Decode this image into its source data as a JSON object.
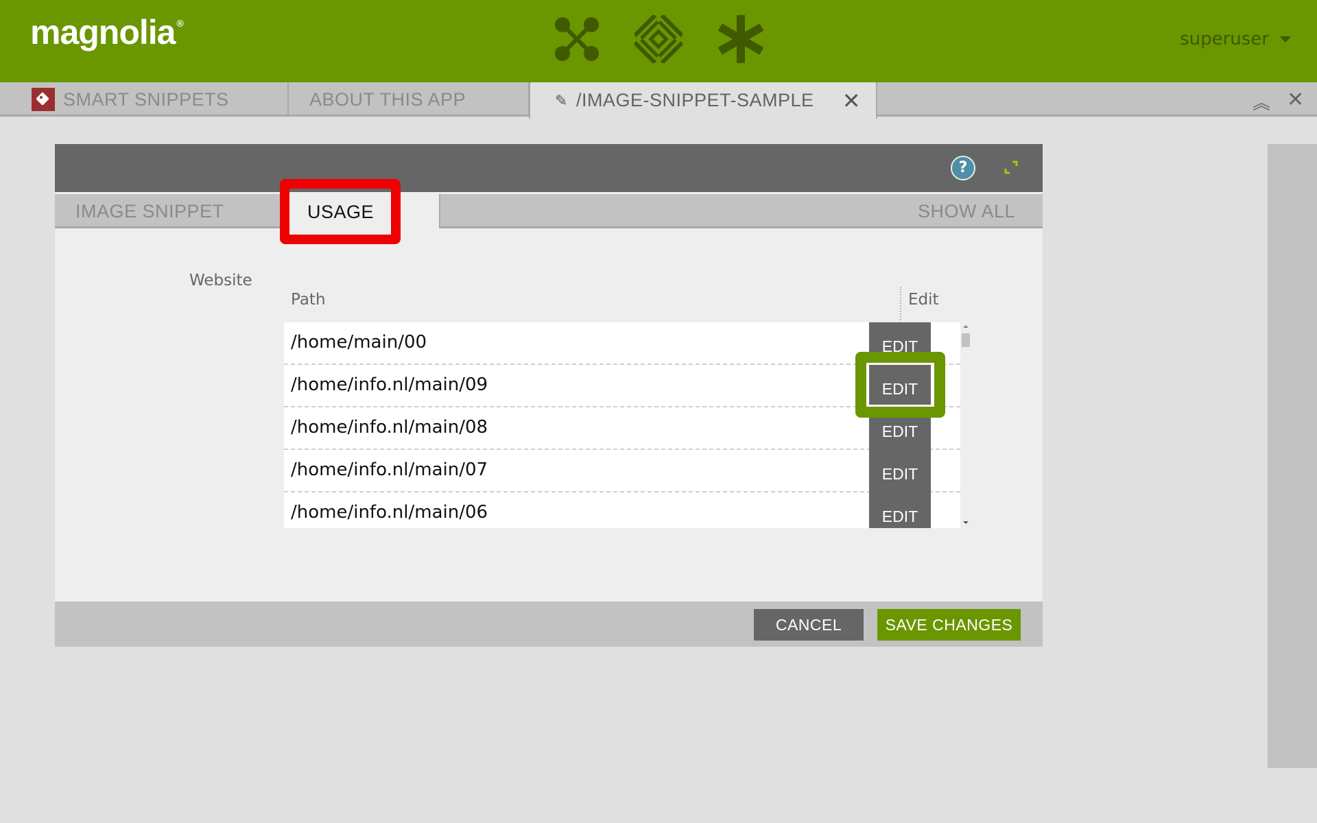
{
  "header": {
    "logo": "magnolia",
    "logo_mark": "®",
    "app_icons": [
      "apps-launcher-icon",
      "pulse-icon",
      "favorites-icon"
    ],
    "user": "superuser"
  },
  "app_tabs": [
    {
      "label": "SMART SNIPPETS",
      "icon": "tag-icon"
    },
    {
      "label": "ABOUT THIS APP"
    },
    {
      "label": "/IMAGE-SNIPPET-SAMPLE",
      "icon": "pencil-icon",
      "active": true
    }
  ],
  "dialog": {
    "tabs": [
      {
        "label": "IMAGE SNIPPET"
      },
      {
        "label": "USAGE",
        "active": true
      }
    ],
    "show_all": "SHOW ALL",
    "help": "?",
    "field_label": "Website",
    "columns": {
      "path": "Path",
      "edit": "Edit"
    },
    "rows": [
      {
        "path": "/home/main/00",
        "action": "EDIT"
      },
      {
        "path": "/home/info.nl/main/09",
        "action": "EDIT"
      },
      {
        "path": "/home/info.nl/main/08",
        "action": "EDIT"
      },
      {
        "path": "/home/info.nl/main/07",
        "action": "EDIT"
      },
      {
        "path": "/home/info.nl/main/06",
        "action": "EDIT"
      }
    ],
    "cancel": "CANCEL",
    "save": "SAVE CHANGES"
  },
  "colors": {
    "brand": "#6a9600",
    "highlight_red": "#ee0000"
  }
}
